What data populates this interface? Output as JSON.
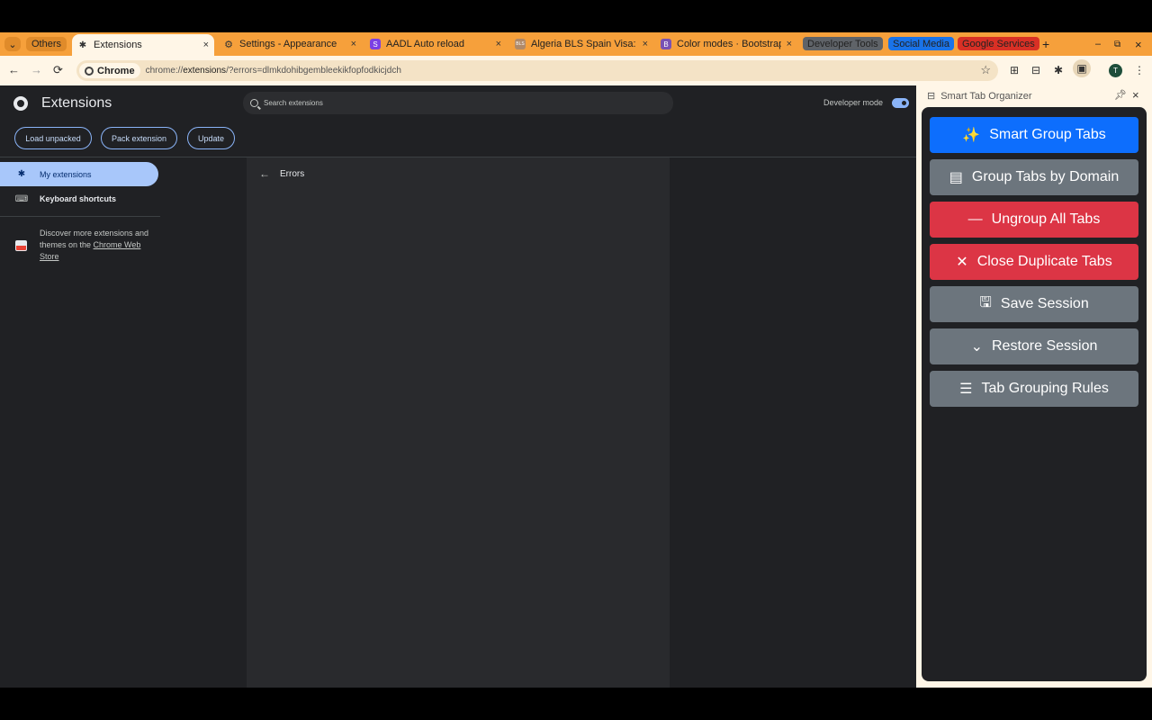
{
  "tabstrip": {
    "search_icon": "chevron-down-icon",
    "group_others": "Others",
    "tabs": [
      {
        "title": "Extensions",
        "favicon": "puzzle-icon"
      },
      {
        "title": "Settings - Appearance",
        "favicon": "gear-icon"
      },
      {
        "title": "AADL Auto reload",
        "favicon": "S"
      },
      {
        "title": "Algeria BLS Spain Visa:",
        "favicon": "BLS"
      },
      {
        "title": "Color modes · Bootstrap",
        "favicon": "B"
      }
    ],
    "close_glyph": "×",
    "groups": [
      {
        "label": "Developer Tools",
        "color": "#5f6368"
      },
      {
        "label": "Social Media",
        "color": "#1a73e8"
      },
      {
        "label": "Google Services",
        "color": "#d93025"
      }
    ],
    "new_tab": "+",
    "window": {
      "minimize": "–",
      "restore": "⧉",
      "close": "×"
    }
  },
  "toolbar": {
    "back": "←",
    "forward": "→",
    "reload": "⟳",
    "chip_label": "Chrome",
    "url_prefix": "chrome://",
    "url_host": "extensions",
    "url_rest": "/?errors=dlmkdohibgembleekikfopfodkicjdch",
    "avatar_letter": "T"
  },
  "extensions": {
    "title": "Extensions",
    "search_placeholder": "Search extensions",
    "developer_mode_label": "Developer mode",
    "developer_mode_on": true,
    "buttons": [
      "Load unpacked",
      "Pack extension",
      "Update"
    ],
    "sidebar": [
      {
        "label": "My extensions",
        "icon": "puzzle-icon",
        "active": true
      },
      {
        "label": "Keyboard shortcuts",
        "icon": "keyboard-icon",
        "active": false
      }
    ],
    "discover_text": "Discover more extensions and themes on the ",
    "discover_link": "Chrome Web Store",
    "errors_title": "Errors"
  },
  "sidepanel": {
    "title": "Smart Tab Organizer",
    "actions": [
      {
        "label": "Smart Group Tabs",
        "icon": "magic-icon",
        "glyph": "✨",
        "color": "#0d6efd"
      },
      {
        "label": "Group Tabs by Domain",
        "icon": "server-icon",
        "glyph": "▤",
        "color": "#6c757d"
      },
      {
        "label": "Ungroup All Tabs",
        "icon": "minus-icon",
        "glyph": "—",
        "color": "#dc3545"
      },
      {
        "label": "Close Duplicate Tabs",
        "icon": "close-icon",
        "glyph": "✕",
        "color": "#dc3545"
      },
      {
        "label": "Save Session",
        "icon": "save-icon",
        "glyph": "🖫",
        "color": "#6c757d"
      },
      {
        "label": "Restore Session",
        "icon": "restore-icon",
        "glyph": "⌄",
        "color": "#6c757d"
      },
      {
        "label": "Tab Grouping Rules",
        "icon": "list-icon",
        "glyph": "☰",
        "color": "#6c757d"
      }
    ]
  }
}
